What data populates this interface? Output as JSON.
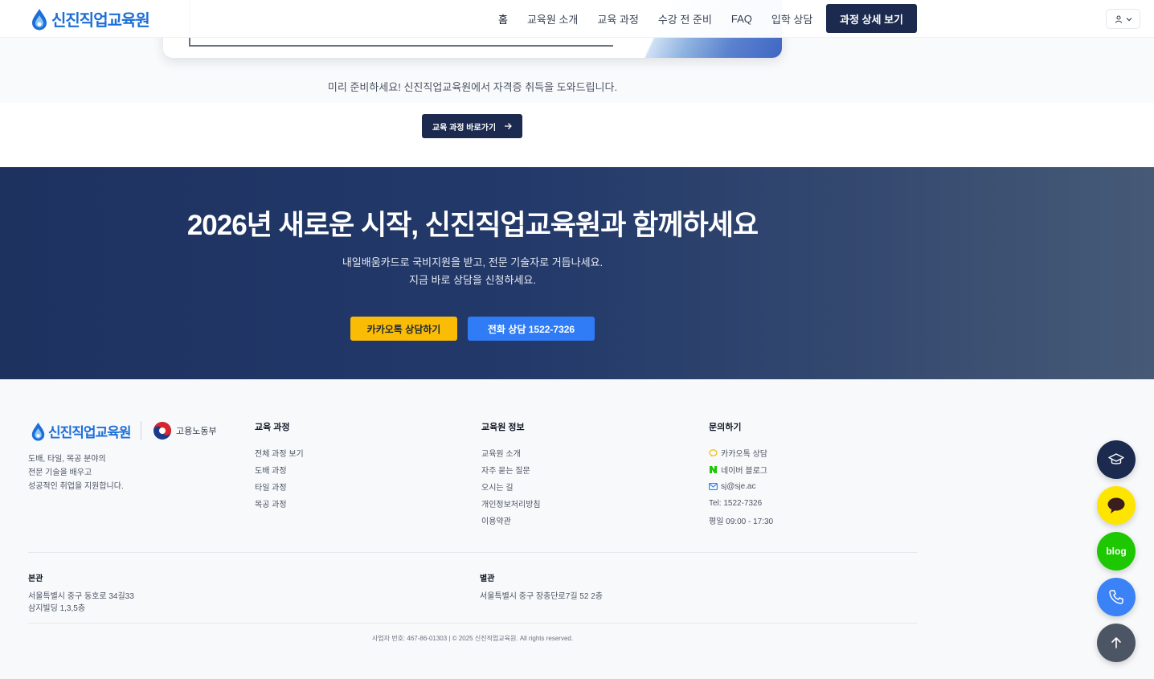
{
  "brand": {
    "name": "신진직업교육원",
    "accent": "#1d6fd8",
    "navy": "#1b2a4e"
  },
  "nav": {
    "items": [
      "홈",
      "교육원 소개",
      "교육 과정",
      "수강 전 준비",
      "FAQ",
      "입학 상담"
    ],
    "cta": "과정 상세 보기"
  },
  "user_menu": {
    "icons": [
      "user-icon",
      "chevron-down-icon"
    ]
  },
  "top_section": {
    "caption": "미리 준비하세요! 신진직업교육원에서 자격증 취득을 도와드립니다.",
    "button": "교육 과정 바로가기"
  },
  "hero": {
    "title": "2026년 새로운 시작, 신진직업교육원과 함께하세요",
    "subtitle_line1": "내일배움카드로 국비지원을 받고, 전문 기술자로 거듭나세요.",
    "subtitle_line2": "지금 바로 상담을 신청하세요.",
    "kakao_button": "카카오톡 상담하기",
    "phone_button": "전화 상담 1522-7326",
    "kakao_color": "#fbbc05",
    "phone_color": "#2f7cf6"
  },
  "footer": {
    "gov_label": "고용노동부",
    "description": [
      "도배, 타일, 목공 분야의",
      "전문 기술을 배우고",
      "성공적인 취업을 지원합니다."
    ],
    "columns": {
      "courses": {
        "title": "교육 과정",
        "items": [
          "전체 과정 보기",
          "도배 과정",
          "타일 과정",
          "목공 과정"
        ]
      },
      "about": {
        "title": "교육원 정보",
        "items": [
          "교육원 소개",
          "자주 묻는 질문",
          "오시는 길",
          "개인정보처리방침",
          "이용약관"
        ]
      },
      "contact": {
        "title": "문의하기",
        "kakao": "카카오톡 상담",
        "blog": "네이버 블로그",
        "email": "sj@sje.ac",
        "tel": "Tel: 1522-7326",
        "hours": "평일 09:00 - 17:30"
      }
    },
    "main_branch": {
      "label": "본관",
      "line1": "서울특별시 중구 동호로 34길33",
      "line2": "삼지빌딩 1,3,5층"
    },
    "annex": {
      "label": "별관",
      "line1": "서울특별시 중구 장충단로7길 52 2층"
    },
    "copyright": "사업자 번호: 467-86-01303 | © 2025 신진직업교육원. All rights reserved."
  },
  "floating": {
    "blog_label": "blog",
    "buttons": [
      "graduation-cap-icon",
      "kakao-chat-icon",
      "blog",
      "phone-icon",
      "arrow-up-icon"
    ]
  }
}
